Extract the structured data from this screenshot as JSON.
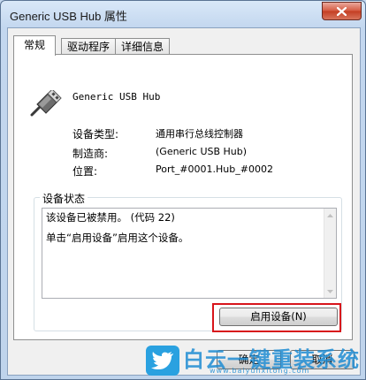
{
  "window": {
    "title": "Generic USB Hub 属性"
  },
  "tabs": [
    {
      "label": "常规",
      "active": true
    },
    {
      "label": "驱动程序",
      "active": false
    },
    {
      "label": "详细信息",
      "active": false
    }
  ],
  "device": {
    "name": "Generic USB Hub",
    "icon": "usb-plug-icon",
    "properties": [
      {
        "label": "设备类型:",
        "value": "通用串行总线控制器"
      },
      {
        "label": "制造商:",
        "value": "(Generic USB Hub)"
      },
      {
        "label": "位置:",
        "value": "Port_#0001.Hub_#0002"
      }
    ]
  },
  "status": {
    "group_label": "设备状态",
    "line1": "该设备已被禁用。 (代码 22)",
    "line2": "单击“启用设备”启用这个设备。"
  },
  "buttons": {
    "enable": "启用设备(N)",
    "ok": "确定",
    "cancel": "取消"
  },
  "watermark": {
    "text": "白云一键重装系统",
    "url": "www.baiyunxitong.com"
  },
  "colors": {
    "highlight": "#d8151b",
    "watermark": "#1e8cd2"
  }
}
